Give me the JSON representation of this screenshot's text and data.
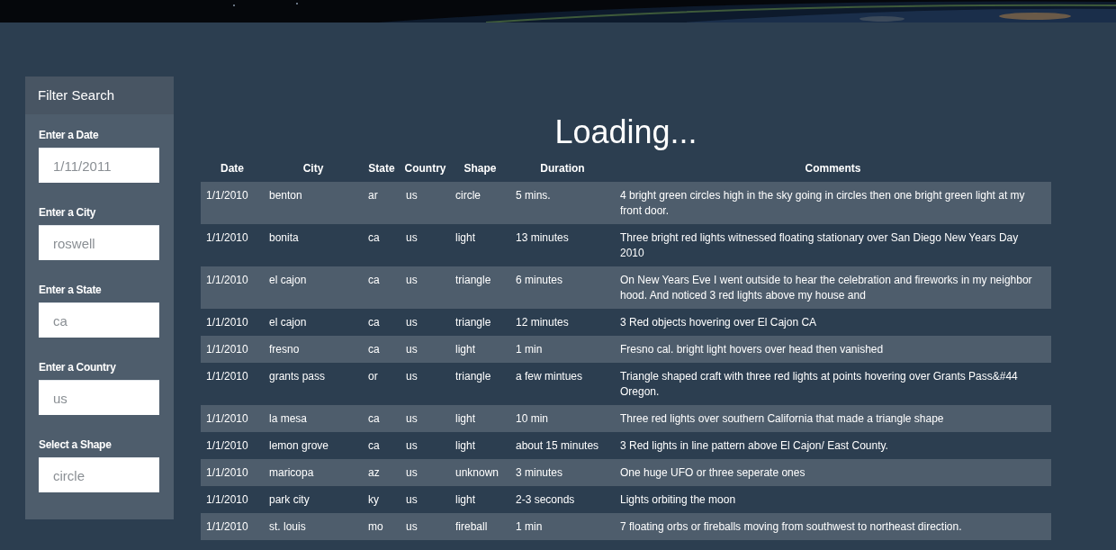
{
  "filter": {
    "title": "Filter Search",
    "fields": [
      {
        "label": "Enter a Date",
        "placeholder": "1/11/2011"
      },
      {
        "label": "Enter a City",
        "placeholder": "roswell"
      },
      {
        "label": "Enter a State",
        "placeholder": "ca"
      },
      {
        "label": "Enter a Country",
        "placeholder": "us"
      },
      {
        "label": "Select a Shape",
        "placeholder": "circle"
      }
    ]
  },
  "heading": "Loading...",
  "table": {
    "columns": [
      "Date",
      "City",
      "State",
      "Country",
      "Shape",
      "Duration",
      "Comments"
    ],
    "rows": [
      [
        "1/1/2010",
        "benton",
        "ar",
        "us",
        "circle",
        "5 mins.",
        "4 bright green circles high in the sky going in circles then one bright green light at my front door."
      ],
      [
        "1/1/2010",
        "bonita",
        "ca",
        "us",
        "light",
        "13 minutes",
        "Three bright red lights witnessed floating stationary over San Diego New Years Day 2010"
      ],
      [
        "1/1/2010",
        "el cajon",
        "ca",
        "us",
        "triangle",
        "6 minutes",
        "On New Years Eve I went outside to hear the celebration and fireworks in my neighbor hood. And noticed 3 red lights above my house and"
      ],
      [
        "1/1/2010",
        "el cajon",
        "ca",
        "us",
        "triangle",
        "12 minutes",
        "3 Red objects hovering over El Cajon CA"
      ],
      [
        "1/1/2010",
        "fresno",
        "ca",
        "us",
        "light",
        "1 min",
        "Fresno cal. bright light hovers over head then vanished"
      ],
      [
        "1/1/2010",
        "grants pass",
        "or",
        "us",
        "triangle",
        "a few mintues",
        "Triangle shaped craft with three red lights at points hovering over Grants Pass&#44 Oregon."
      ],
      [
        "1/1/2010",
        "la mesa",
        "ca",
        "us",
        "light",
        "10 min",
        "Three red lights over southern California that made a triangle shape"
      ],
      [
        "1/1/2010",
        "lemon grove",
        "ca",
        "us",
        "light",
        "about 15 minutes",
        "3 Red lights in line pattern above El Cajon/ East County."
      ],
      [
        "1/1/2010",
        "maricopa",
        "az",
        "us",
        "unknown",
        "3 minutes",
        "One huge UFO or three seperate ones"
      ],
      [
        "1/1/2010",
        "park city",
        "ky",
        "us",
        "light",
        "2-3 seconds",
        "Lights orbiting the moon"
      ],
      [
        "1/1/2010",
        "st. louis",
        "mo",
        "us",
        "fireball",
        "1 min",
        "7 floating orbs or fireballs moving from southwest to northeast direction."
      ]
    ]
  }
}
